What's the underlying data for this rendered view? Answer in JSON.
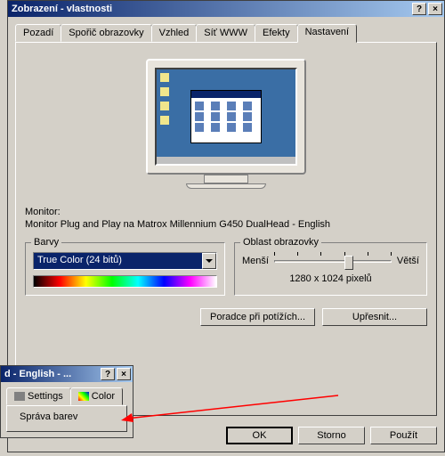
{
  "window": {
    "title": "Zobrazení - vlastnosti",
    "help_btn": "?",
    "close_btn": "×"
  },
  "tabs": [
    {
      "label": "Pozadí"
    },
    {
      "label": "Spořič obrazovky"
    },
    {
      "label": "Vzhled"
    },
    {
      "label": "Síť WWW"
    },
    {
      "label": "Efekty"
    },
    {
      "label": "Nastavení"
    }
  ],
  "active_tab": 5,
  "monitor_section": {
    "label": "Monitor:",
    "value": "Monitor Plug and Play na Matrox Millennium G450 DualHead - English"
  },
  "colors_group": {
    "title": "Barvy",
    "selected": "True Color (24 bitů)"
  },
  "area_group": {
    "title": "Oblast obrazovky",
    "less": "Menší",
    "more": "Větší",
    "resolution": "1280 x 1024 pixelů"
  },
  "buttons": {
    "troubleshoot": "Poradce při potížích...",
    "advanced": "Upřesnit...",
    "ok": "OK",
    "cancel": "Storno",
    "apply": "Použít"
  },
  "second_window": {
    "title": "d - English - ...",
    "help_btn": "?",
    "close_btn": "×",
    "tabs": [
      {
        "label": "Settings"
      },
      {
        "label": "Color"
      }
    ],
    "panel_label": "Správa barev"
  }
}
